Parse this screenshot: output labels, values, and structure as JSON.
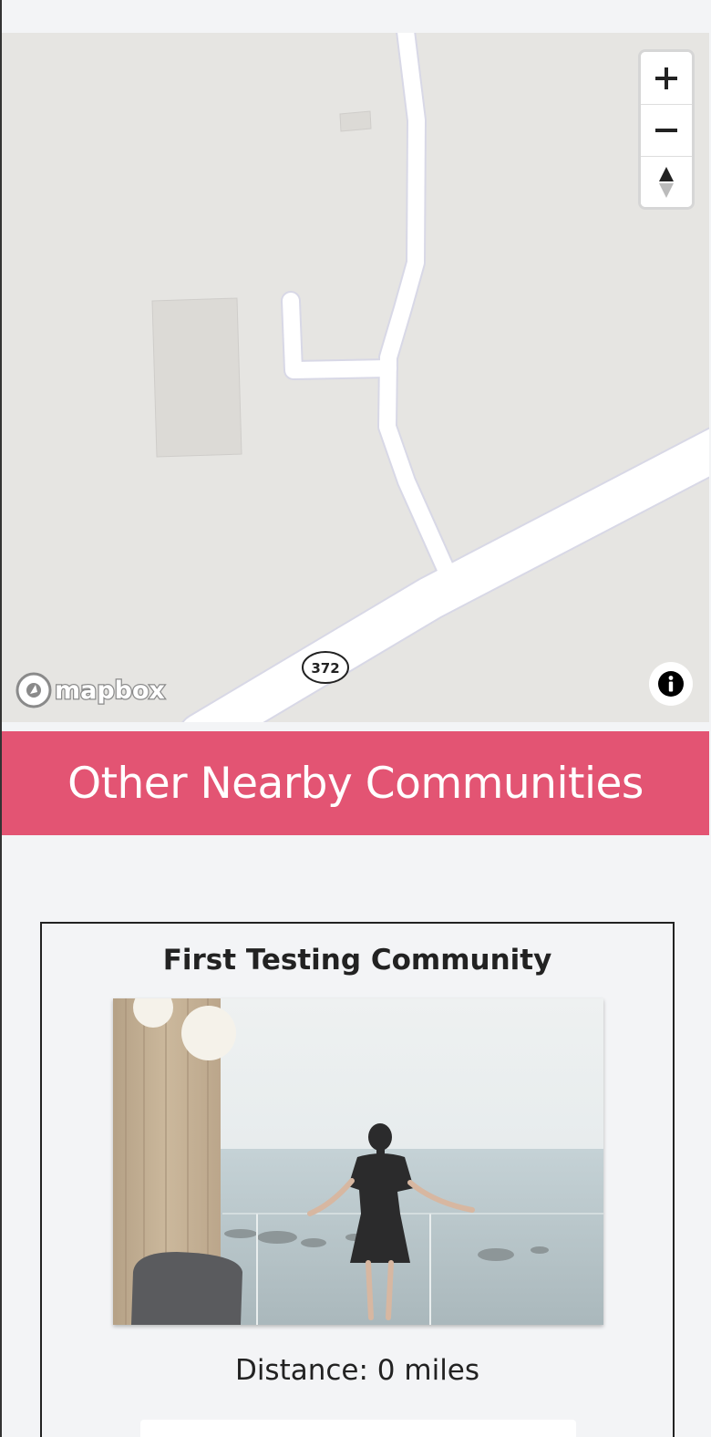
{
  "map": {
    "route_shield": "372",
    "logo_text": "mapbox",
    "controls": {
      "zoom_in_icon": "plus-icon",
      "zoom_out_icon": "minus-icon",
      "compass_icon": "compass-icon"
    },
    "attribution_icon": "info-icon",
    "colors": {
      "land": "#e6e5e2",
      "road": "#ffffff",
      "road_casing": "#d8d8e6",
      "building": "#dcdad6"
    }
  },
  "nearby": {
    "heading": "Other Nearby Communities",
    "banner_color": "#e35473",
    "communities": [
      {
        "name": "First Testing Community",
        "distance_text": "Distance: 0 miles",
        "photo_icon": "community-photo"
      }
    ]
  }
}
